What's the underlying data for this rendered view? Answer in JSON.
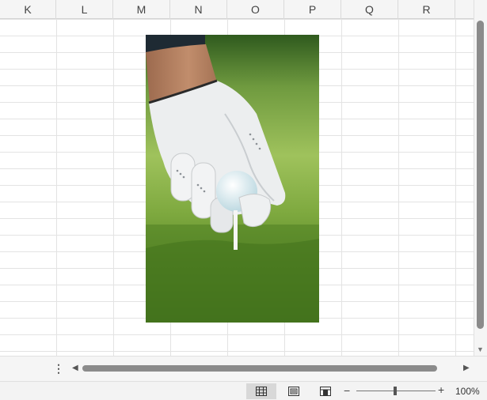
{
  "columns": [
    "K",
    "L",
    "M",
    "N",
    "O",
    "P",
    "Q",
    "R"
  ],
  "picture": {
    "name": "golf-ball-tee-photo"
  },
  "horizontal_scroll": {
    "more_icon": "more-vertical-icon",
    "left_icon": "scroll-left-icon",
    "right_icon": "scroll-right-icon"
  },
  "status_bar": {
    "views": [
      "normal-view-icon",
      "page-layout-view-icon",
      "page-break-preview-icon"
    ],
    "zoom_minus": "−",
    "zoom_plus": "+",
    "zoom_value": "100%",
    "zoom_level_percent": 100
  }
}
